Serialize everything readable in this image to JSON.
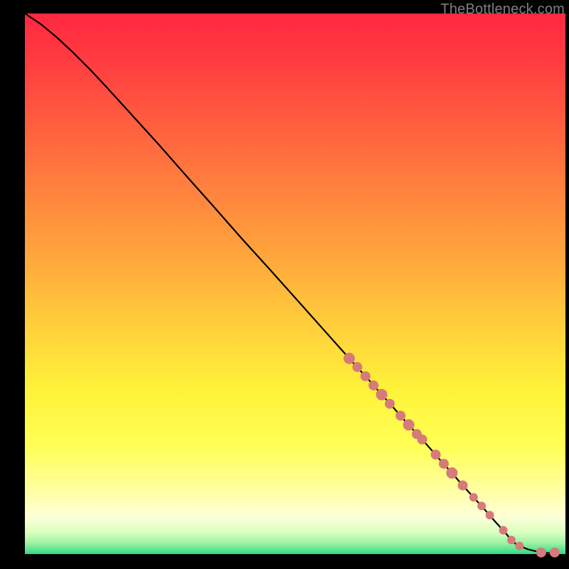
{
  "watermark": "TheBottleneck.com",
  "colors": {
    "line": "#000000",
    "dot_fill": "#d77a7a",
    "dot_stroke": "#b55a5a",
    "background": "#000000"
  },
  "chart_data": {
    "type": "line",
    "title": "",
    "xlabel": "",
    "ylabel": "",
    "xlim": [
      0,
      100
    ],
    "ylim": [
      0,
      100
    ],
    "grid": false,
    "legend": false,
    "series": [
      {
        "name": "curve",
        "x": [
          0,
          3,
          6,
          9,
          12,
          15,
          20,
          25,
          30,
          35,
          40,
          45,
          50,
          55,
          60,
          62,
          64,
          66,
          68,
          70,
          72,
          73.5,
          75,
          77,
          79,
          81,
          83,
          85,
          87,
          89,
          90,
          91,
          93,
          95,
          96.5,
          98
        ],
        "y": [
          100,
          98,
          95.5,
          92.7,
          89.7,
          86.5,
          81,
          75.5,
          69.8,
          64.2,
          58.5,
          53,
          47.4,
          41.8,
          36.2,
          34,
          31.8,
          29.5,
          27.3,
          25,
          22.8,
          21.2,
          19.5,
          17.2,
          15,
          12.7,
          10.5,
          8.3,
          6,
          3.8,
          2.6,
          1.7,
          0.9,
          0.4,
          0.2,
          0.2
        ]
      }
    ],
    "scatter": {
      "name": "dots",
      "x": [
        60,
        61.5,
        63,
        64.5,
        66,
        67.5,
        69.5,
        71,
        72.5,
        73.5,
        76,
        77.5,
        79,
        81,
        83,
        84.5,
        86,
        88.5,
        90,
        91.5,
        95.5,
        98
      ],
      "y": [
        36.2,
        34.6,
        32.9,
        31.2,
        29.5,
        27.8,
        25.6,
        23.9,
        22.2,
        21.2,
        18.4,
        16.7,
        15,
        12.7,
        10.5,
        8.9,
        7.2,
        4.4,
        2.6,
        1.5,
        0.3,
        0.3
      ],
      "r": [
        8,
        7,
        7,
        7,
        8,
        7,
        7,
        8,
        7,
        7,
        7,
        7,
        8,
        7,
        6,
        6,
        6,
        6,
        6,
        6,
        7,
        7
      ]
    }
  }
}
